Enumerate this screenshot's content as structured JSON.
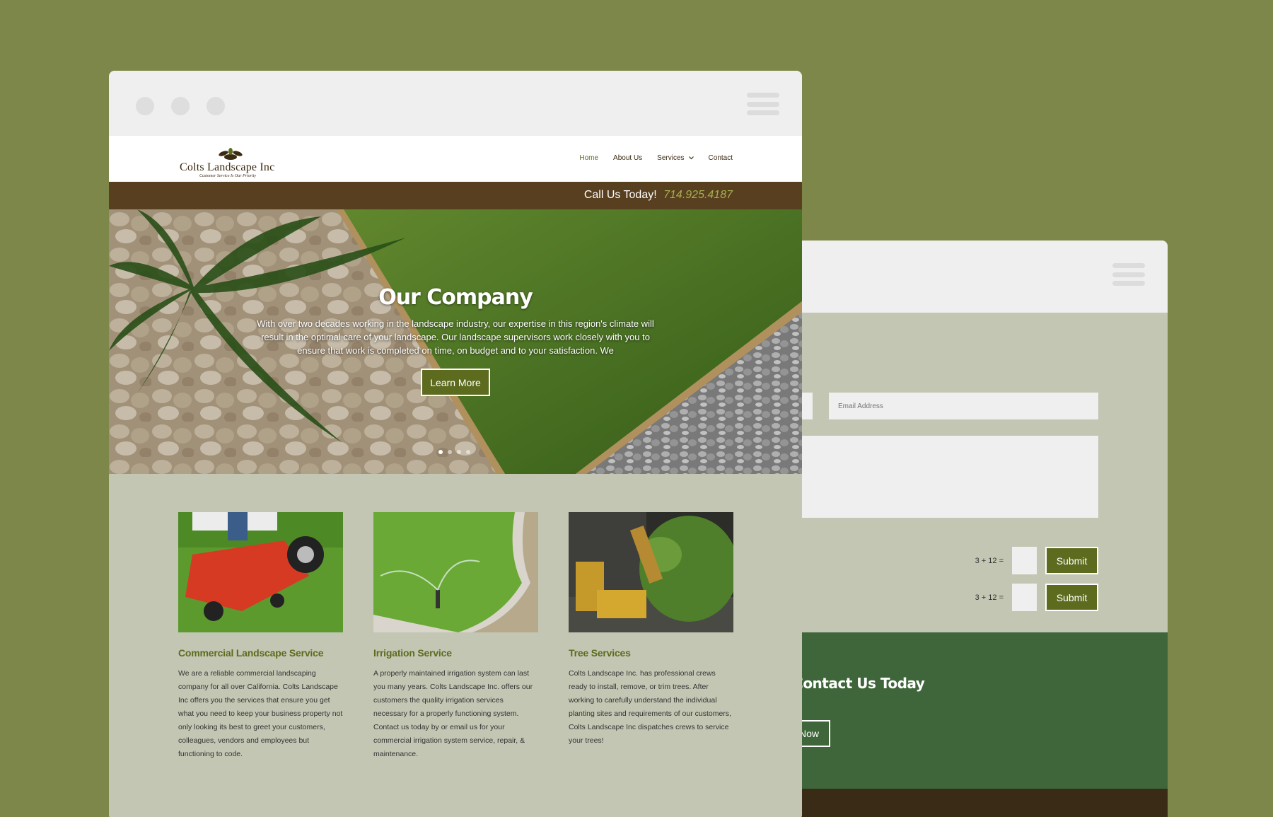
{
  "site": {
    "logo_name": "Colts Landscape Inc",
    "logo_tagline": "Customer Service Is Our Priority",
    "nav": [
      {
        "label": "Home",
        "active": true
      },
      {
        "label": "About Us"
      },
      {
        "label": "Services",
        "has_dropdown": true
      },
      {
        "label": "Contact"
      }
    ],
    "call_label": "Call Us Today!",
    "phone": "714.925.4187",
    "hero": {
      "title": "Our Company",
      "text": "With over two decades working in the landscape industry, our expertise in this region's climate will result in the optimal care of your landscape. Our landscape supervisors work closely with you to ensure that work is completed on time, on budget and to your satisfaction. We",
      "button": "Learn More",
      "slides": 4,
      "active_slide": 1
    },
    "services": [
      {
        "title": "Commercial Landscape Service",
        "text": "We are a reliable commercial landscaping company for all over California. Colts Landscape Inc offers you the services that ensure you get what you need to keep your business property not only looking its best to greet your customers, colleagues, vendors and employees but functioning to code."
      },
      {
        "title": "Irrigation Service",
        "text": "A properly maintained irrigation system can last you many years. Colts Landscape Inc. offers our customers the quality irrigation services necessary for a properly functioning system. Contact us today by or email us for your commercial irrigation system service, repair, & maintenance."
      },
      {
        "title": "Tree Services",
        "text": "Colts Landscape Inc. has professional crews ready to install, remove, or trim trees.  After working to carefully understand the individual planting sites and requirements of our customers, Colts Landscape Inc dispatches crews to service your trees!"
      }
    ]
  },
  "contact_page": {
    "email_placeholder": "Email Address",
    "captcha_label": "3 + 12 =",
    "submit_label": "Submit",
    "cta_title": "er. Contact Us Today",
    "cta_button": "in Touch Now"
  },
  "colors": {
    "background": "#7c8749",
    "brand_green": "#5d6b1f",
    "brown_bar": "#573f1f",
    "cta_green": "#3f663a",
    "page_bg": "#c2c6b2",
    "phone": "#a7b04e"
  }
}
